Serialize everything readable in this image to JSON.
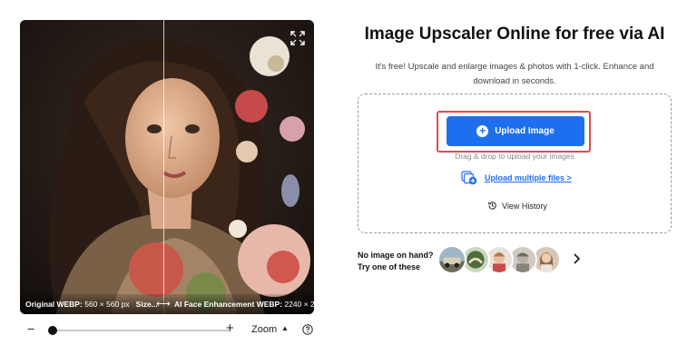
{
  "preview": {
    "caption_left_label": "Original WEBP:",
    "caption_left_value": "560 × 560 px",
    "caption_size_label": "Size...",
    "caption_arrow": "⟷",
    "caption_right_label": "AI Face Enhancement WEBP:",
    "caption_right_value": "2240 × 2..."
  },
  "zoom": {
    "minus": "−",
    "plus": "+",
    "label": "Zoom",
    "caret": "▲"
  },
  "header": {
    "title": "Image Upscaler Online for free via AI",
    "subtitle": "It's free! Upscale and enlarge images & photos with 1-click. Enhance and download in seconds."
  },
  "upload": {
    "button_label": "Upload Image",
    "drag_text": "Drag & drop to upload your images",
    "multiple_label": "Upload multiple files >",
    "history_label": "View History"
  },
  "samples": {
    "line1": "No image on hand?",
    "line2": "Try one of these"
  },
  "colors": {
    "accent": "#1e6ef0",
    "highlight": "#e04b4b"
  }
}
